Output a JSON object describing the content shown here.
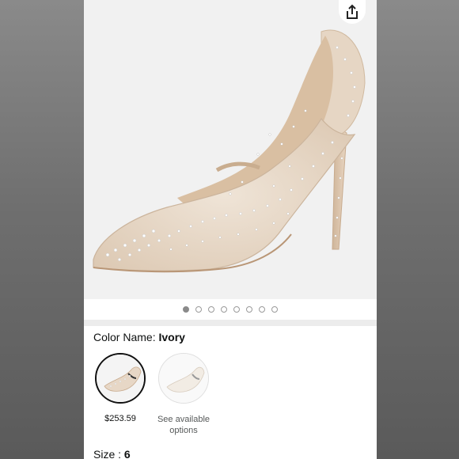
{
  "carousel": {
    "dot_count": 8,
    "active_index": 0
  },
  "color": {
    "label": "Color Name: ",
    "value": "Ivory"
  },
  "swatches": [
    {
      "price": "$253.59"
    },
    {
      "text_line1": "See available",
      "text_line2": "options"
    }
  ],
  "size": {
    "label": "Size : ",
    "value": "6"
  },
  "colors": {
    "background": "#5c5c5c",
    "panel": "#ffffff",
    "text": "#0f1111",
    "shoe": "#ead9c6"
  },
  "icons": {
    "share": "share-icon"
  }
}
